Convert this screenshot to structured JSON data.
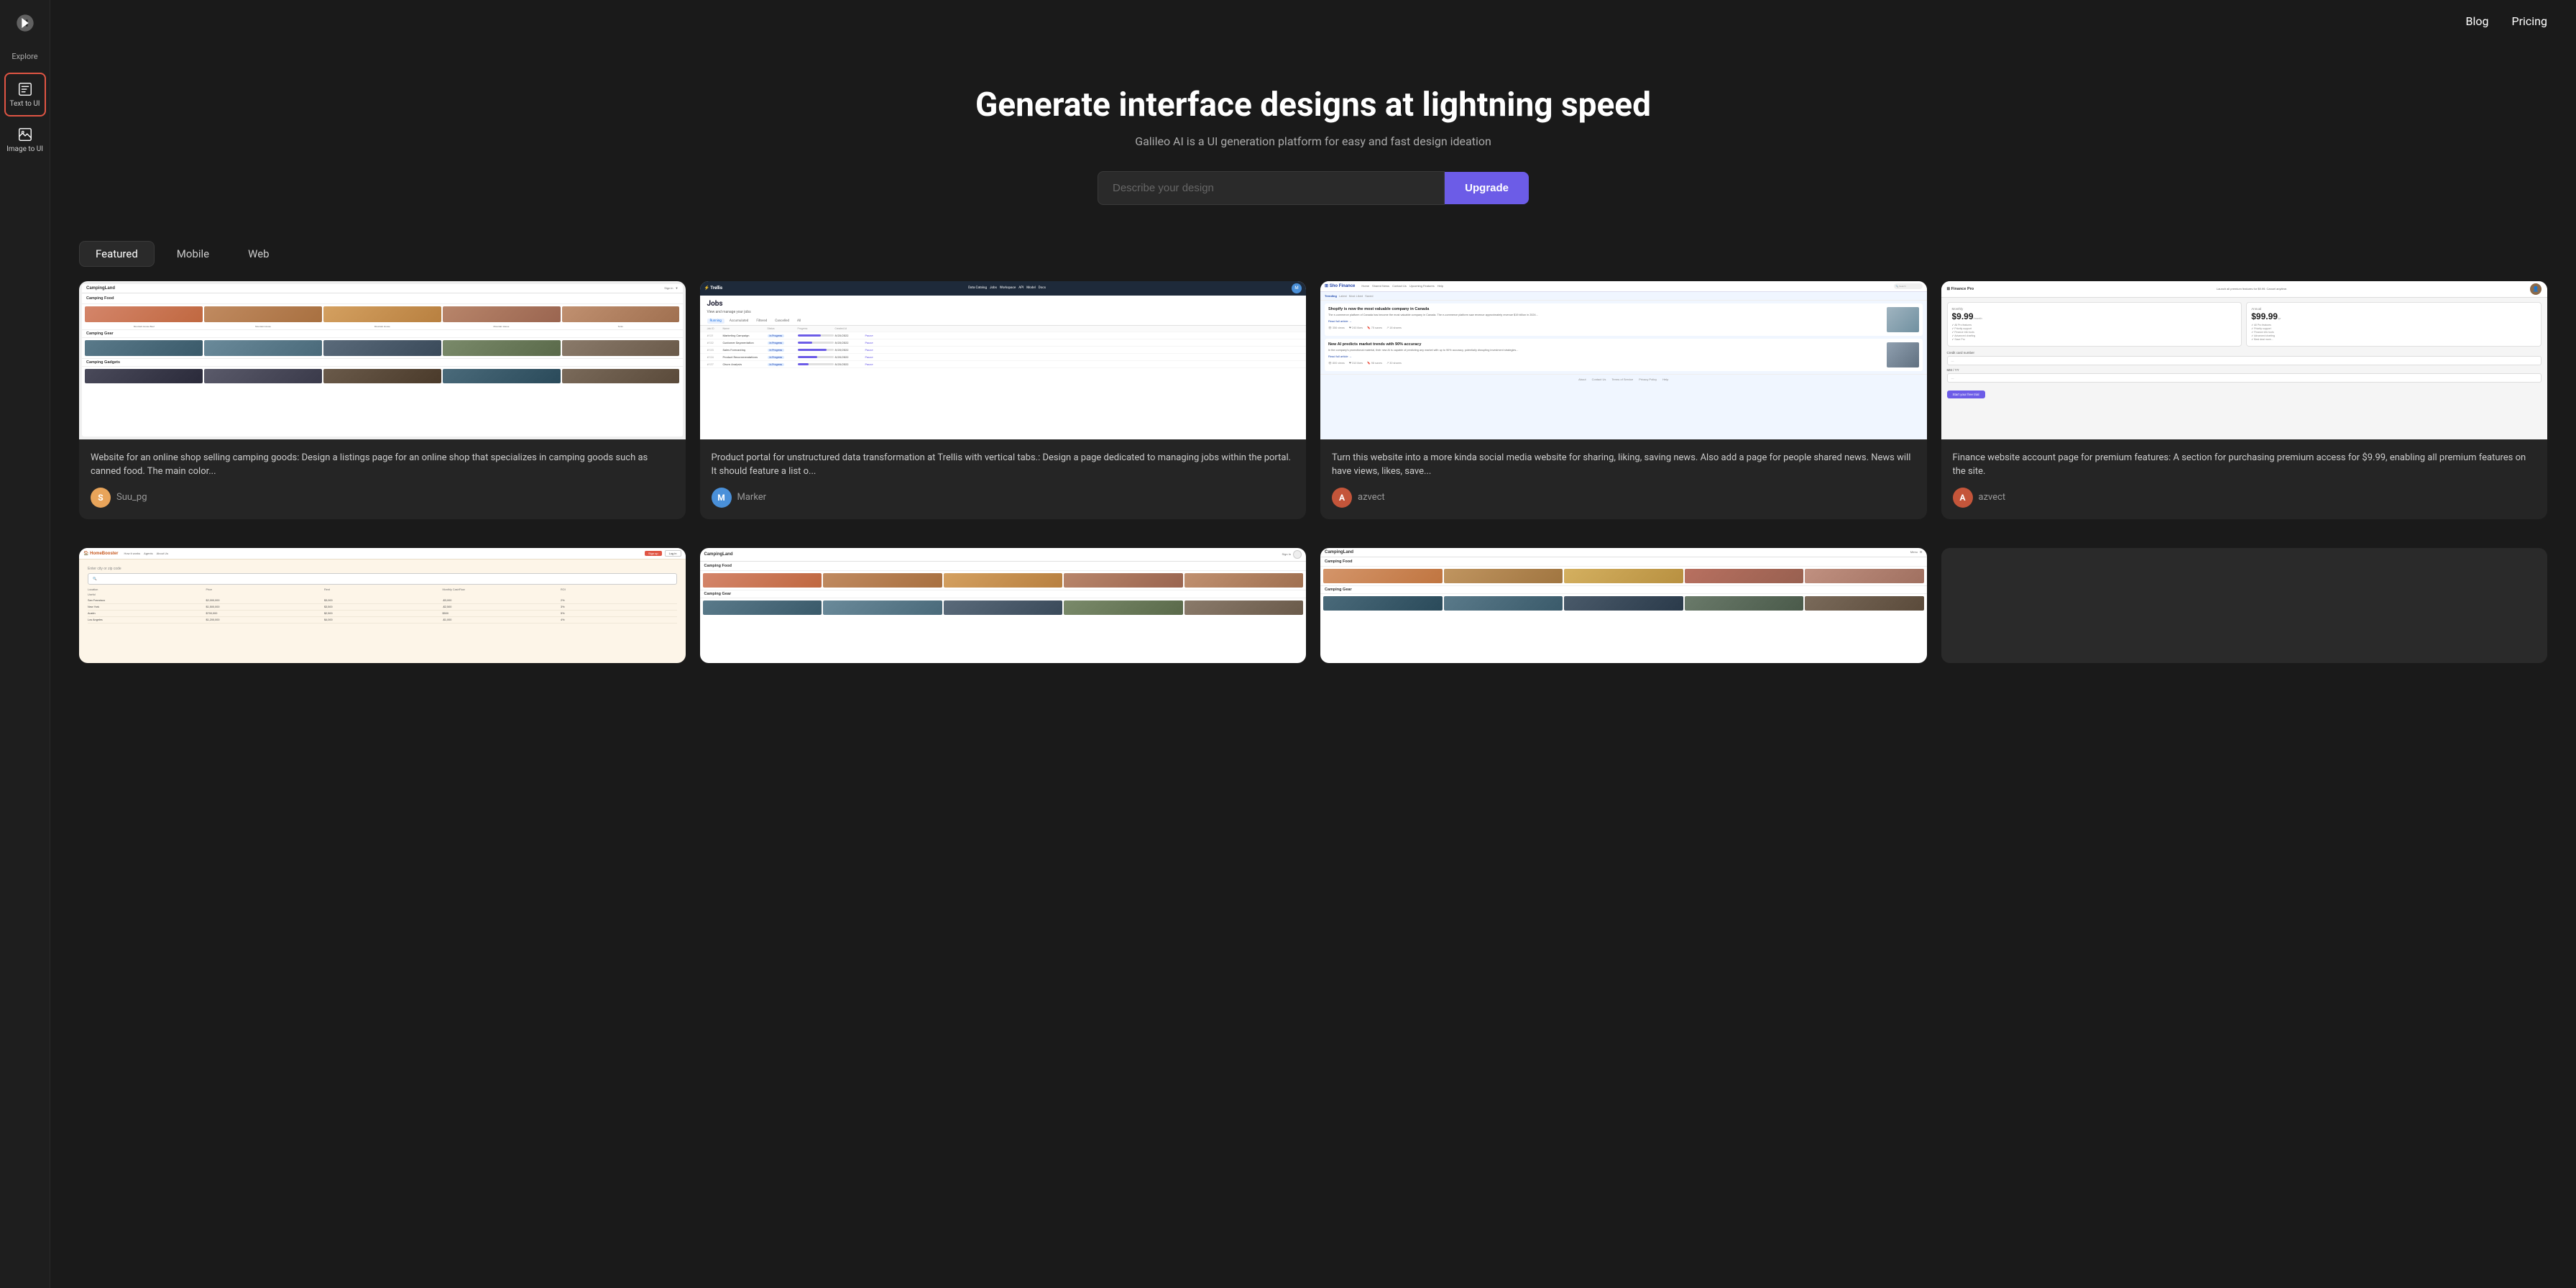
{
  "nav": {
    "blog_label": "Blog",
    "pricing_label": "Pricing"
  },
  "sidebar": {
    "logo_label": "Galileo AI",
    "explore_label": "Explore",
    "text_to_ui_label": "Text to UI",
    "image_to_ui_label": "Image to UI"
  },
  "hero": {
    "headline": "Generate interface designs at lightning speed",
    "subtext": "Galileo AI is a UI generation platform for easy and fast design ideation",
    "input_placeholder": "Describe your design",
    "upgrade_button": "Upgrade"
  },
  "tabs": [
    {
      "id": "featured",
      "label": "Featured",
      "active": true
    },
    {
      "id": "mobile",
      "label": "Mobile",
      "active": false
    },
    {
      "id": "web",
      "label": "Web",
      "active": false
    }
  ],
  "cards": [
    {
      "id": "card-1",
      "description": "Website for an online shop selling camping goods: Design a listings page for an online shop that specializes in camping goods such as canned food. The main color...",
      "author": "Suu_pg",
      "avatar_color": "#e8a45a",
      "avatar_initial": "S"
    },
    {
      "id": "card-2",
      "description": "Product portal for unstructured data transformation at Trellis with vertical tabs.: Design a page dedicated to managing jobs within the portal. It should feature a list o...",
      "author": "Marker",
      "avatar_color": "#4a90d9",
      "avatar_initial": "M"
    },
    {
      "id": "card-3",
      "description": "Turn this website into a more kinda social media website for sharing, liking, saving news. Also add a page for people shared news. News will have views, likes, save...",
      "author": "azvect",
      "avatar_color": "#c4553a",
      "avatar_initial": "A"
    },
    {
      "id": "card-4",
      "description": "Finance website account page for premium features: A section for purchasing premium access for $9.99, enabling all premium features on the site.",
      "author": "azvect",
      "avatar_color": "#c4553a",
      "avatar_initial": "A"
    }
  ],
  "bottom_cards": [
    {
      "id": "bc-1",
      "type": "homebooster"
    },
    {
      "id": "bc-2",
      "type": "camping2"
    },
    {
      "id": "bc-3",
      "type": "camping3"
    }
  ],
  "colors": {
    "accent_purple": "#6c5ce7",
    "accent_red": "#e05544",
    "sidebar_bg": "#1e1e1e",
    "card_bg": "#252525",
    "body_bg": "#1a1a1a"
  }
}
